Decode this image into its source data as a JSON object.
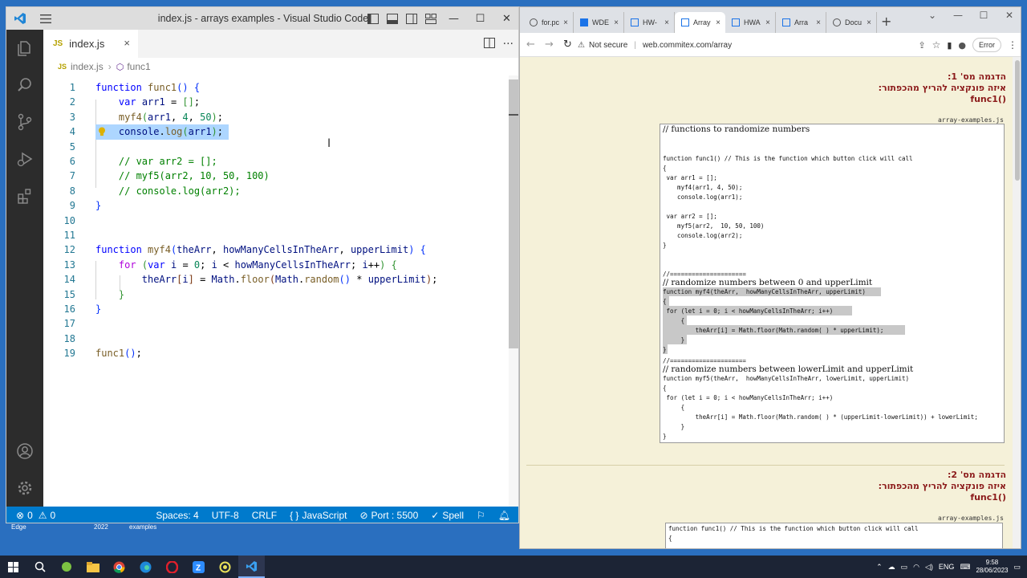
{
  "vscode": {
    "title": "index.js - arrays examples - Visual Studio Code",
    "tab": {
      "icon_text": "JS",
      "label": "index.js",
      "close": "×"
    },
    "breadcrumb": {
      "file_icon": "JS",
      "file": "index.js",
      "separator": "›",
      "symbol": "func1"
    },
    "code_lines": [
      {
        "n": "1"
      },
      {
        "n": "2"
      },
      {
        "n": "3"
      },
      {
        "n": "4"
      },
      {
        "n": "5"
      },
      {
        "n": "6"
      },
      {
        "n": "7"
      },
      {
        "n": "8"
      },
      {
        "n": "9"
      },
      {
        "n": "10"
      },
      {
        "n": "11"
      },
      {
        "n": "12"
      },
      {
        "n": "13"
      },
      {
        "n": "14"
      },
      {
        "n": "15"
      },
      {
        "n": "16"
      },
      {
        "n": "17"
      },
      {
        "n": "18"
      },
      {
        "n": "19"
      }
    ],
    "status": {
      "errors": "0",
      "warnings": "0",
      "spaces": "Spaces: 4",
      "encoding": "UTF-8",
      "eol": "CRLF",
      "language_symbol": "{ }",
      "language": "JavaScript",
      "port": "Port : 5500",
      "spell": "Spell"
    },
    "colors": {
      "statusbar": "#007acc",
      "activitybar": "#2c2c2c",
      "selection": "#add6ff"
    }
  },
  "chrome": {
    "tabs": [
      {
        "label": "for.pc"
      },
      {
        "label": "WDE"
      },
      {
        "label": "HW-"
      },
      {
        "label": "Array",
        "active": true
      },
      {
        "label": "HWA"
      },
      {
        "label": "Arra"
      },
      {
        "label": "Docu"
      }
    ],
    "tab_close": "×",
    "new_tab": "+",
    "not_secure": "Not secure",
    "url": "web.commitex.com/array",
    "error_button": "Error",
    "examples": [
      {
        "line1": "הדגמה מס' 1:",
        "line2": "איזה פונקציה להריץ מהכפתור:",
        "line3": "func1()"
      },
      {
        "line1": "הדגמה מס' 2:",
        "line2": "איזה פונקציה להריץ מהכפתור:",
        "line3": "func1()"
      }
    ],
    "file_label": "array-examples.js",
    "code_box_1": [
      "// functions to randomize numbers",
      "function func1() // This is the function which button click will call",
      "{",
      " var arr1 = [];",
      "    myf4(arr1, 4, 50);",
      "    console.log(arr1);",
      " var arr2 = [];",
      "    myf5(arr2,  10, 50, 100)",
      "    console.log(arr2);",
      "}",
      "//=====================",
      "// randomize numbers between 0 and upperLimit",
      "function myf4(theArr,  howManyCellsInTheArr, upperLimit)",
      "{",
      " for (let i = 0; i < howManyCellsInTheArr; i++)",
      "     {",
      "         theArr[i] = Math.floor(Math.random( ) * upperLimit);",
      "     }",
      "}",
      "//=====================",
      "// randomize numbers between lowerLimit and upperLimit",
      "function myf5(theArr,  howManyCellsInTheArr, lowerLimit, upperLimit)",
      "{",
      " for (let i = 0; i < howManyCellsInTheArr; i++)",
      "     {",
      "         theArr[i] = Math.floor(Math.random( ) * (upperLimit-lowerLimit)) + lowerLimit;",
      "     }",
      "}"
    ],
    "code_box_2": [
      "function func1() // This is the function which button click will call",
      "{"
    ]
  },
  "desktop_labels": [
    "Edge",
    "2022",
    "examples"
  ],
  "taskbar": {
    "language": "ENG",
    "time": "9:58",
    "date": "28/06/2023"
  }
}
